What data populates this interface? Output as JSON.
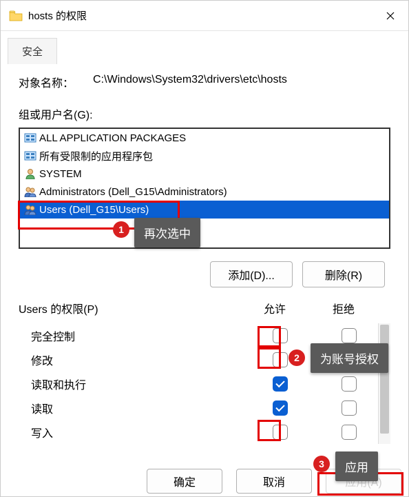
{
  "window": {
    "title": "hosts 的权限"
  },
  "tabs": {
    "security": "安全"
  },
  "object": {
    "label": "对象名称：",
    "value": "C:\\Windows\\System32\\drivers\\etc\\hosts"
  },
  "groups": {
    "label": "组或用户名(G):",
    "items": [
      {
        "name": "ALL APPLICATION PACKAGES",
        "icon": "pkg"
      },
      {
        "name": "所有受限制的应用程序包",
        "icon": "pkg"
      },
      {
        "name": "SYSTEM",
        "icon": "user"
      },
      {
        "name": "Administrators (Dell_G15\\Administrators)",
        "icon": "group"
      },
      {
        "name": "Users (Dell_G15\\Users)",
        "icon": "group",
        "selected": true
      }
    ],
    "add_btn": "添加(D)...",
    "remove_btn": "删除(R)"
  },
  "annotations": {
    "a1": "再次选中",
    "a2": "为账号授权",
    "a3": "应用"
  },
  "permissions": {
    "label": "Users 的权限(P)",
    "allow": "允许",
    "deny": "拒绝",
    "rows": [
      {
        "name": "完全控制",
        "allow": false,
        "deny": false
      },
      {
        "name": "修改",
        "allow": false,
        "deny": false
      },
      {
        "name": "读取和执行",
        "allow": true,
        "deny": false
      },
      {
        "name": "读取",
        "allow": true,
        "deny": false
      },
      {
        "name": "写入",
        "allow": false,
        "deny": false
      }
    ]
  },
  "footer": {
    "ok": "确定",
    "cancel": "取消",
    "apply": "应用(A)"
  }
}
